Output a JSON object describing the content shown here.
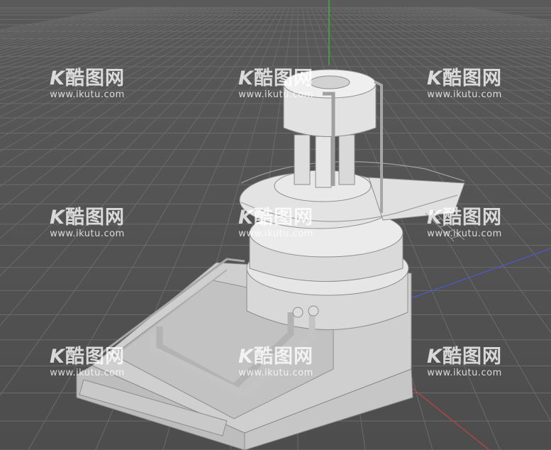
{
  "viewport": {
    "background": "#4f4f4f",
    "grid_color": "#6b6b6b",
    "axis_colors": {
      "y": "#3fbf3f",
      "x": "#c04444",
      "z": "#4a5ad0"
    }
  },
  "model": {
    "base_color": "#d6d6d6",
    "shadow_color": "#b4b4b4",
    "highlight_color": "#f2f2f2"
  },
  "watermark": {
    "brand_letter": "K",
    "brand_text": "酷图网",
    "url": "www.ikutu.com"
  }
}
